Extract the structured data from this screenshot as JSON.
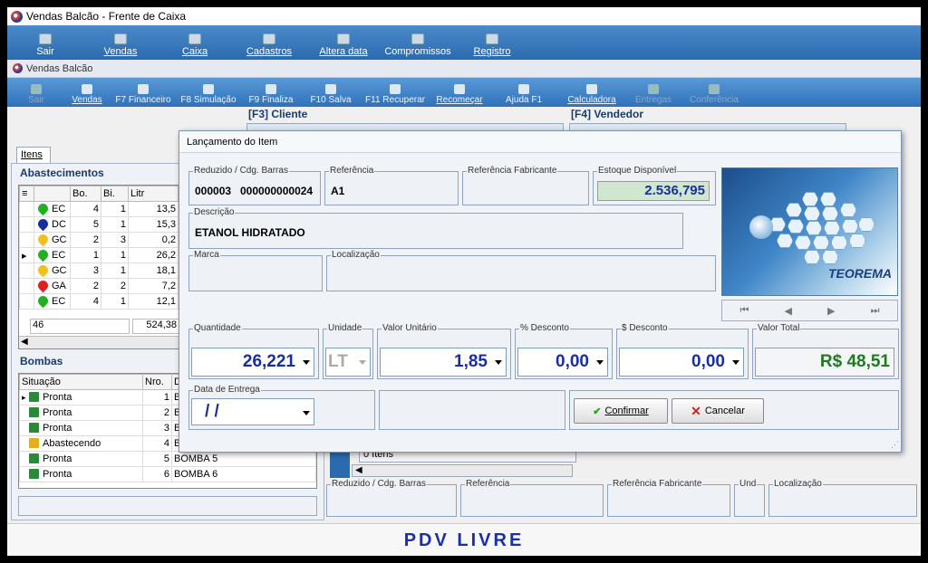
{
  "window": {
    "title": "Vendas Balcão - Frente de Caixa"
  },
  "topmenu": [
    {
      "label": "Sair"
    },
    {
      "label": "Vendas"
    },
    {
      "label": "Caixa"
    },
    {
      "label": "Cadastros"
    },
    {
      "label": "Altera data"
    },
    {
      "label": "Compromissos"
    },
    {
      "label": "Registro"
    }
  ],
  "subwindow": {
    "title": "Vendas Balcão"
  },
  "toolbar": [
    {
      "label": "Sair",
      "disabled": true
    },
    {
      "label": "Vendas"
    },
    {
      "label": "F7 Financeiro"
    },
    {
      "label": "F8 Simulação"
    },
    {
      "label": "F9 Finaliza"
    },
    {
      "label": "F10 Salva"
    },
    {
      "label": "F11 Recuperar"
    },
    {
      "label": "Recomeçar"
    },
    {
      "label": "Ajuda F1"
    },
    {
      "label": "Calculadora"
    },
    {
      "label": "Entregas",
      "disabled": true
    },
    {
      "label": "Conferência",
      "disabled": true
    }
  ],
  "cliente": {
    "label": "[F3] Cliente"
  },
  "vendedor": {
    "label": "[F4] Vendedor"
  },
  "left": {
    "tab": "Itens",
    "abastecimentos": {
      "title": "Abastecimentos",
      "headers": [
        "Bo.",
        "Bi.",
        "Litr"
      ],
      "rows": [
        {
          "fuel": "EC",
          "color": "#22b022",
          "bo": "4",
          "bi": "1",
          "litros": "13,5",
          "marker": ""
        },
        {
          "fuel": "DC",
          "color": "#1a2f9e",
          "bo": "5",
          "bi": "1",
          "litros": "15,3",
          "marker": ""
        },
        {
          "fuel": "GC",
          "color": "#f0c020",
          "bo": "2",
          "bi": "3",
          "litros": "0,2",
          "marker": ""
        },
        {
          "fuel": "EC",
          "color": "#22b022",
          "bo": "1",
          "bi": "1",
          "litros": "26,2",
          "marker": "▸"
        },
        {
          "fuel": "GC",
          "color": "#f0c020",
          "bo": "3",
          "bi": "1",
          "litros": "18,1",
          "marker": ""
        },
        {
          "fuel": "GA",
          "color": "#e02020",
          "bo": "2",
          "bi": "2",
          "litros": "7,2",
          "marker": ""
        },
        {
          "fuel": "EC",
          "color": "#22b022",
          "bo": "4",
          "bi": "1",
          "litros": "12,1",
          "marker": ""
        }
      ],
      "count": "46",
      "total": "524,38"
    },
    "bombas": {
      "title": "Bombas",
      "headers": [
        "Situação",
        "Nro.",
        "D"
      ],
      "rows": [
        {
          "situacao": "Pronta",
          "nro": "1",
          "desc": "B",
          "marker": "▸",
          "busy": false
        },
        {
          "situacao": "Pronta",
          "nro": "2",
          "desc": "B",
          "marker": "",
          "busy": false
        },
        {
          "situacao": "Pronta",
          "nro": "3",
          "desc": "B",
          "marker": "",
          "busy": false
        },
        {
          "situacao": "Abastecendo",
          "nro": "4",
          "desc": "BOMBA 4",
          "marker": "",
          "busy": true
        },
        {
          "situacao": "Pronta",
          "nro": "5",
          "desc": "BOMBA 5",
          "marker": "",
          "busy": false
        },
        {
          "situacao": "Pronta",
          "nro": "6",
          "desc": "BOMBA 6",
          "marker": "",
          "busy": false
        }
      ]
    }
  },
  "lower": {
    "items_count": "0 Itens",
    "headers": [
      "Reduzido / Cdg. Barras",
      "Referência",
      "Referência Fabricante",
      "Und",
      "Localização"
    ]
  },
  "footer": {
    "text": "PDV LIVRE"
  },
  "dialog": {
    "title": "Lançamento do Item",
    "reduzido": {
      "label": "Reduzido / Cdg. Barras",
      "code": "000003",
      "barcode": "000000000024"
    },
    "referencia": {
      "label": "Referência",
      "value": "A1"
    },
    "ref_fabricante": {
      "label": "Referência Fabricante",
      "value": ""
    },
    "estoque": {
      "label": "Estoque Disponível",
      "value": "2.536,795"
    },
    "descricao": {
      "label": "Descrição",
      "value": "ETANOL HIDRATADO"
    },
    "marca": {
      "label": "Marca",
      "value": ""
    },
    "localizacao": {
      "label": "Localização",
      "value": ""
    },
    "logo_text": "TEOREMA",
    "nav": [
      "⏮",
      "◀",
      "▶",
      "⏭"
    ],
    "quantidade": {
      "label": "Quantidade",
      "value": "26,221"
    },
    "unidade": {
      "label": "Unidade",
      "value": "LT"
    },
    "valor_unitario": {
      "label": "Valor Unitário",
      "value": "1,85"
    },
    "pct_desconto": {
      "label": "% Desconto",
      "value": "0,00"
    },
    "valor_desconto": {
      "label": "$ Desconto",
      "value": "0,00"
    },
    "valor_total": {
      "label": "Valor Total",
      "value": "R$ 48,51"
    },
    "data_entrega": {
      "label": "Data de Entrega",
      "value": "/ /"
    },
    "confirmar": "Confirmar",
    "cancelar": "Cancelar"
  }
}
